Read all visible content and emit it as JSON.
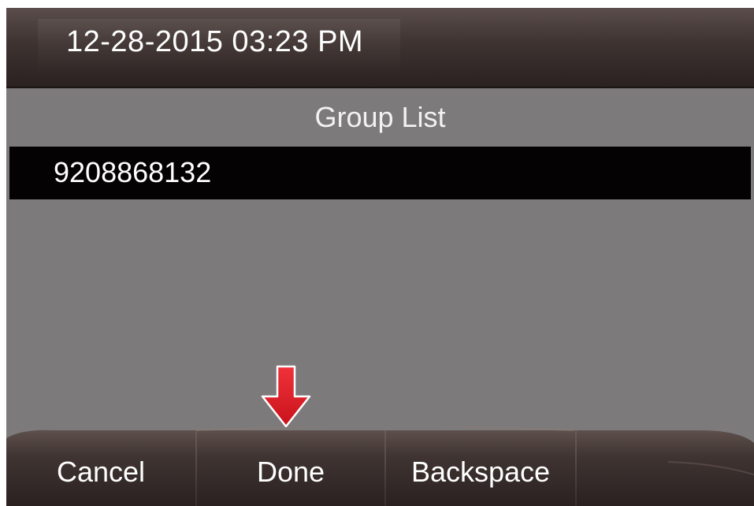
{
  "status_bar": {
    "datetime": "12-28-2015 03:23 PM"
  },
  "screen": {
    "title": "Group List",
    "list_items": [
      {
        "label": "9208868132",
        "selected": true
      }
    ]
  },
  "softkeys": [
    {
      "label": "Cancel"
    },
    {
      "label": "Done"
    },
    {
      "label": "Backspace"
    },
    {
      "label": ""
    }
  ],
  "indicator": {
    "icon": "down-arrow-icon",
    "color": "#e8202a"
  },
  "colors": {
    "screen_bg": "#7d7a7b",
    "status_bar": "#3e3331",
    "selected_row": "#050203",
    "text": "#ffffff"
  }
}
